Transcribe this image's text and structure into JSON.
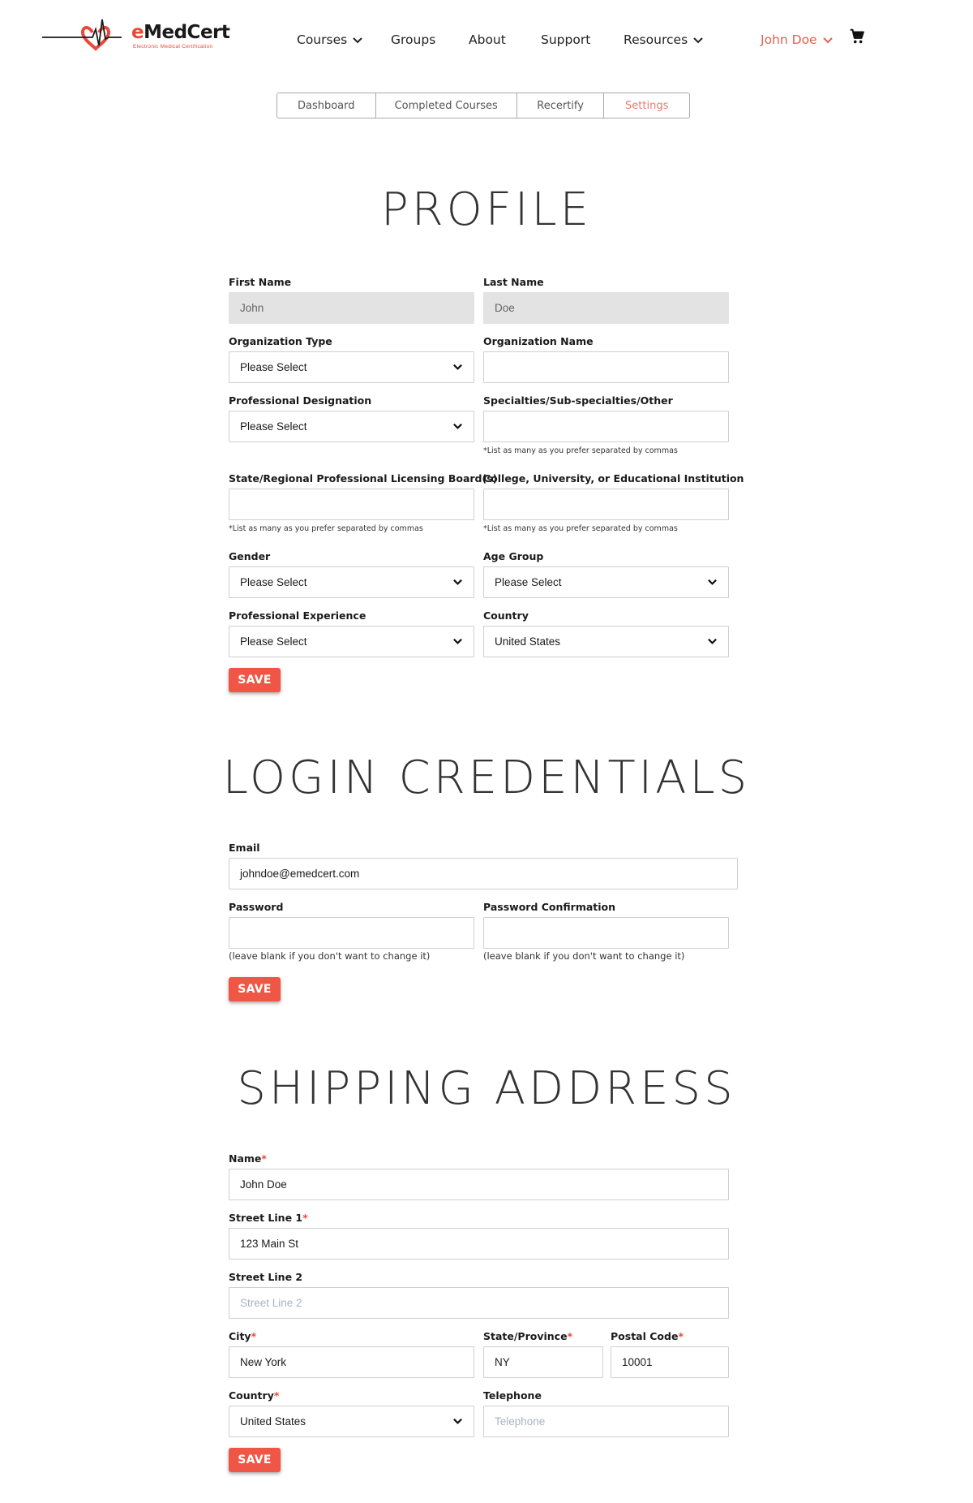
{
  "brand": {
    "name_prefix": "e",
    "name_rest": "MedCert",
    "tagline": "Electronic Medical Certification",
    "accent": "#e8493a"
  },
  "nav": {
    "courses": "Courses",
    "groups": "Groups",
    "about": "About",
    "support": "Support",
    "resources": "Resources",
    "user": "John Doe",
    "cart_icon": "shopping-cart-icon"
  },
  "tabs": [
    {
      "label": "Dashboard"
    },
    {
      "label": "Completed Courses"
    },
    {
      "label": "Recertify"
    },
    {
      "label": "Settings",
      "active": true
    }
  ],
  "profile": {
    "title": "PROFILE",
    "first_name": {
      "label": "First Name",
      "value": "John"
    },
    "last_name": {
      "label": "Last Name",
      "value": "Doe"
    },
    "org_type": {
      "label": "Organization Type",
      "value": "Please Select"
    },
    "org_name": {
      "label": "Organization Name",
      "value": ""
    },
    "prof_designation": {
      "label": "Professional Designation",
      "value": "Please Select"
    },
    "specialties": {
      "label": "Specialties/Sub-specialties/Other",
      "value": "",
      "hint": "*List as many as you prefer separated by commas"
    },
    "licensing_board": {
      "label": "State/Regional Professional Licensing Board(s)",
      "value": "",
      "hint": "*List as many as you prefer separated by commas"
    },
    "institution": {
      "label": "College, University, or Educational Institution",
      "value": "",
      "hint": "*List as many as you prefer separated by commas"
    },
    "gender": {
      "label": "Gender",
      "value": "Please Select"
    },
    "age_group": {
      "label": "Age Group",
      "value": "Please Select"
    },
    "experience": {
      "label": "Professional Experience",
      "value": "Please Select"
    },
    "country": {
      "label": "Country",
      "value": "United States"
    },
    "save": "SAVE"
  },
  "login": {
    "title": "LOGIN CREDENTIALS",
    "email": {
      "label": "Email",
      "value": "johndoe@emedcert.com"
    },
    "password": {
      "label": "Password",
      "value": "",
      "hint": "(leave blank if you don't want to change it)"
    },
    "password_confirm": {
      "label": "Password Confirmation",
      "value": "",
      "hint": "(leave blank if you don't want to change it)"
    },
    "save": "SAVE"
  },
  "shipping": {
    "title": "SHIPPING ADDRESS",
    "name": {
      "label": "Name",
      "value": "John Doe"
    },
    "street1": {
      "label": "Street Line 1",
      "value": "123 Main St"
    },
    "street2": {
      "label": "Street Line 2",
      "placeholder": "Street Line 2"
    },
    "city": {
      "label": "City",
      "value": "New York"
    },
    "state": {
      "label": "State/Province",
      "value": "NY"
    },
    "postal": {
      "label": "Postal Code",
      "value": "10001"
    },
    "country": {
      "label": "Country",
      "value": "United States"
    },
    "telephone": {
      "label": "Telephone",
      "placeholder": "Telephone"
    },
    "required_marker": "*",
    "save": "SAVE"
  }
}
